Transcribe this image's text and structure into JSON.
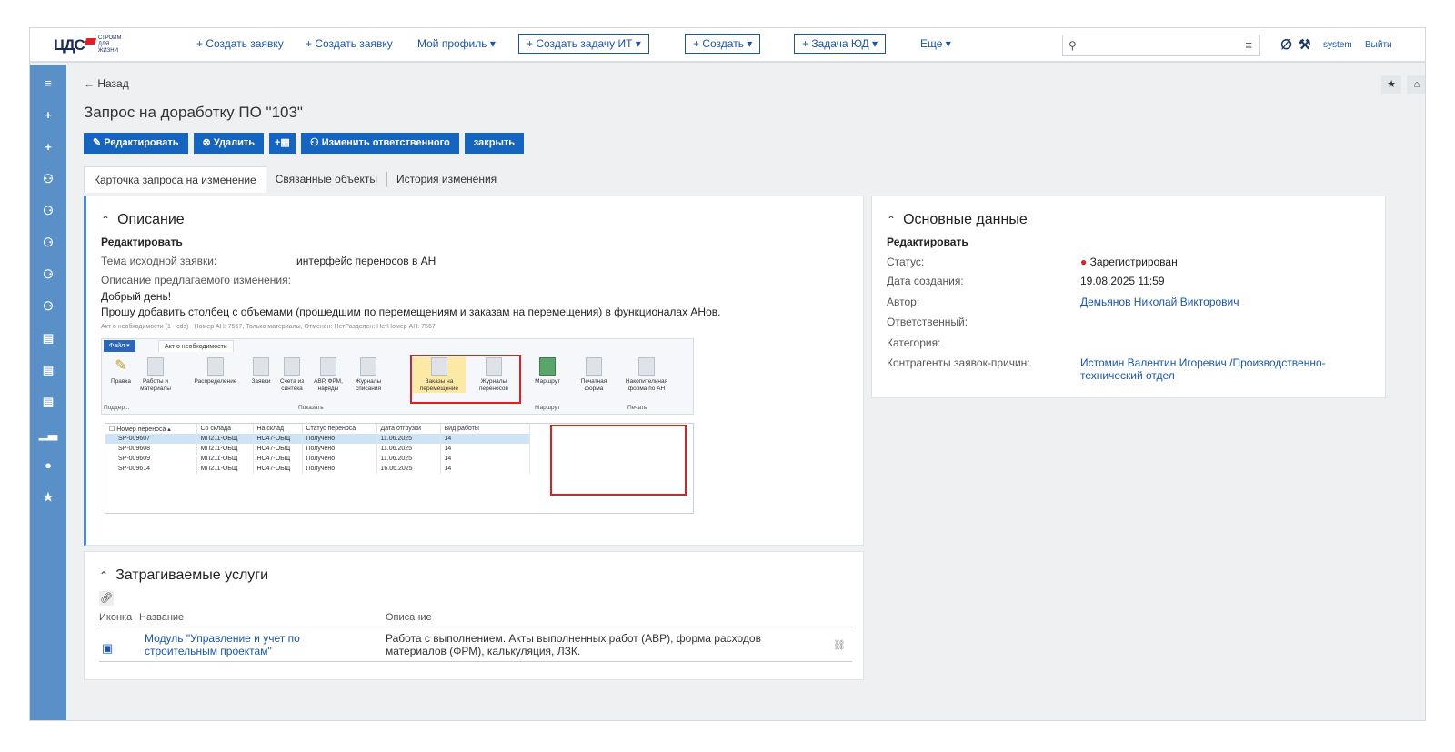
{
  "topbar": {
    "logo_text": "ЦДС",
    "logo_sub": "СТРОИМ ДЛЯ ЖИЗНИ",
    "nav": [
      "+ Создать заявку",
      "+ Создать заявку",
      "Мой профиль ▾"
    ],
    "boxes": [
      "+ Создать задачу ИТ ▾",
      "+ Создать ▾",
      "+ Задача ЮД ▾"
    ],
    "more": "Еще ▾",
    "search_icon": "search-icon",
    "filter_icon": "filter-icon",
    "user": "system",
    "logout": "Выйти"
  },
  "sidebar": {
    "icons": [
      "menu-icon",
      "plus-icon",
      "plus-icon",
      "users-icon",
      "user-add-icon",
      "user-icon",
      "user-icon",
      "user-icon",
      "report-icon",
      "report-icon",
      "report-icon",
      "chart-icon",
      "settings-icon",
      "star-icon"
    ]
  },
  "page": {
    "back": "← Назад",
    "title": "Запрос на доработку ПО \"103\"",
    "buttons": {
      "edit": "Редактировать",
      "delete": "Удалить",
      "change_owner": "Изменить ответственного",
      "close": "закрыть"
    },
    "tabs": [
      "Карточка запроса на изменение",
      "Связанные объекты",
      "История изменения"
    ]
  },
  "description": {
    "header": "Описание",
    "edit": "Редактировать",
    "topic_label": "Тема исходной заявки:",
    "topic_value": "интерфейс переносов в АН",
    "change_label": "Описание предлагаемого изменения:",
    "line1": "Добрый день!",
    "line2": "Прошу добавить столбец с объемами (прошедшим по перемещениям и заказам на перемещения) в функционалах АНов.",
    "screenshot": {
      "caption": "Акт о необходимости (1 - cds) - Номер АН: 7567, Только материалы, Отменён: НетРазделен: НетНомер АН: 7567",
      "file_tab": "Файл ▾",
      "act_tab": "Акт о необходимости",
      "ribbon": [
        "Правка",
        "Работы и материалы",
        "Распределение",
        "Заявки",
        "Счета из синтека",
        "АВР, ФРМ, наряды",
        "Журналы списания",
        "Заказы на перемещение",
        "Журналы переносов",
        "Маршрут",
        "Печатная форма",
        "Накопительная форма по АН"
      ],
      "groups": [
        "Поддер...",
        "Показать",
        "Маршрут",
        "Печать"
      ],
      "columns": [
        "Номер переноса",
        "Со склада",
        "На склад",
        "Статус переноса",
        "Дата отгрузки",
        "Вид работы"
      ],
      "rows": [
        [
          "SP-009607",
          "МП211-ОБЩ",
          "НС47-ОБЩ",
          "Получено",
          "11.06.2025",
          "14"
        ],
        [
          "SP-009608",
          "МП211-ОБЩ",
          "НС47-ОБЩ",
          "Получено",
          "11.06.2025",
          "14"
        ],
        [
          "SP-009609",
          "МП211-ОБЩ",
          "НС47-ОБЩ",
          "Получено",
          "11.06.2025",
          "14"
        ],
        [
          "SP-009614",
          "МП211-ОБЩ",
          "НС47-ОБЩ",
          "Получено",
          "16.06.2025",
          "14"
        ]
      ]
    }
  },
  "main_data": {
    "header": "Основные данные",
    "edit": "Редактировать",
    "status_label": "Статус:",
    "status_value": "Зарегистрирован",
    "status_color": "#e02020",
    "created_label": "Дата создания:",
    "created_value": "19.08.2025 11:59",
    "author_label": "Автор:",
    "author_value": "Демьянов Николай Викторович",
    "owner_label": "Ответственный:",
    "category_label": "Категория:",
    "contractors_label": "Контрагенты заявок-причин:",
    "contractors_value1": "Истомин Валентин Игоревич /Производственно-",
    "contractors_value2": "технический отдел"
  },
  "services": {
    "header": "Затрагиваемые услуги",
    "col_icon": "Иконка",
    "col_name": "Название",
    "col_desc": "Описание",
    "row": {
      "name1": "Модуль \"Управление и учет по",
      "name2": "строительным проектам\"",
      "desc1": "Работа с выполнением. Акты выполненных работ (АВР), форма расходов",
      "desc2": "материалов (ФРМ), калькуляция, ЛЗК."
    }
  },
  "colors": {
    "primary": "#1565c0",
    "sidebar": "#5a90c8",
    "link": "#1a55a8"
  }
}
